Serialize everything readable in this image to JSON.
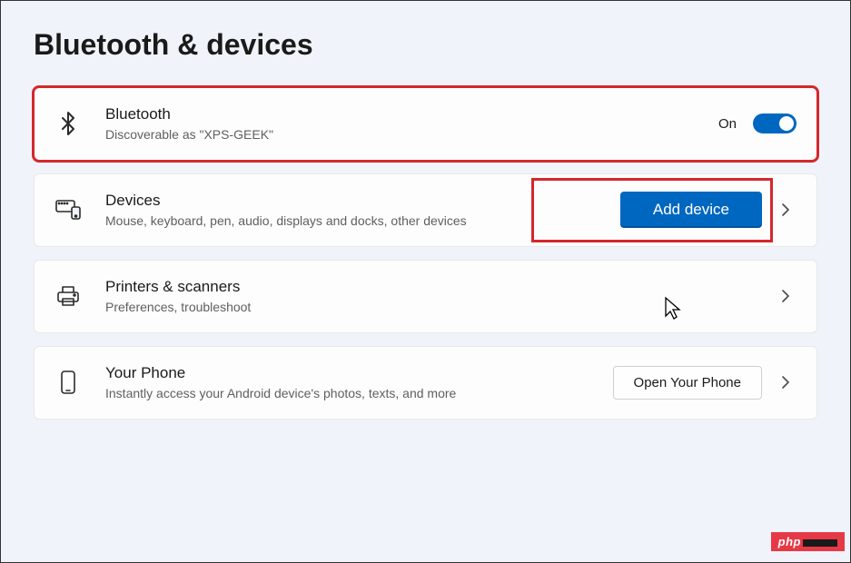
{
  "page_title": "Bluetooth & devices",
  "bluetooth": {
    "title": "Bluetooth",
    "subtitle": "Discoverable as \"XPS-GEEK\"",
    "state_label": "On",
    "state": true
  },
  "devices": {
    "title": "Devices",
    "subtitle": "Mouse, keyboard, pen, audio, displays and docks, other devices",
    "action_label": "Add device"
  },
  "printers": {
    "title": "Printers & scanners",
    "subtitle": "Preferences, troubleshoot"
  },
  "phone": {
    "title": "Your Phone",
    "subtitle": "Instantly access your Android device's photos, texts, and more",
    "action_label": "Open Your Phone"
  },
  "watermark": "php"
}
